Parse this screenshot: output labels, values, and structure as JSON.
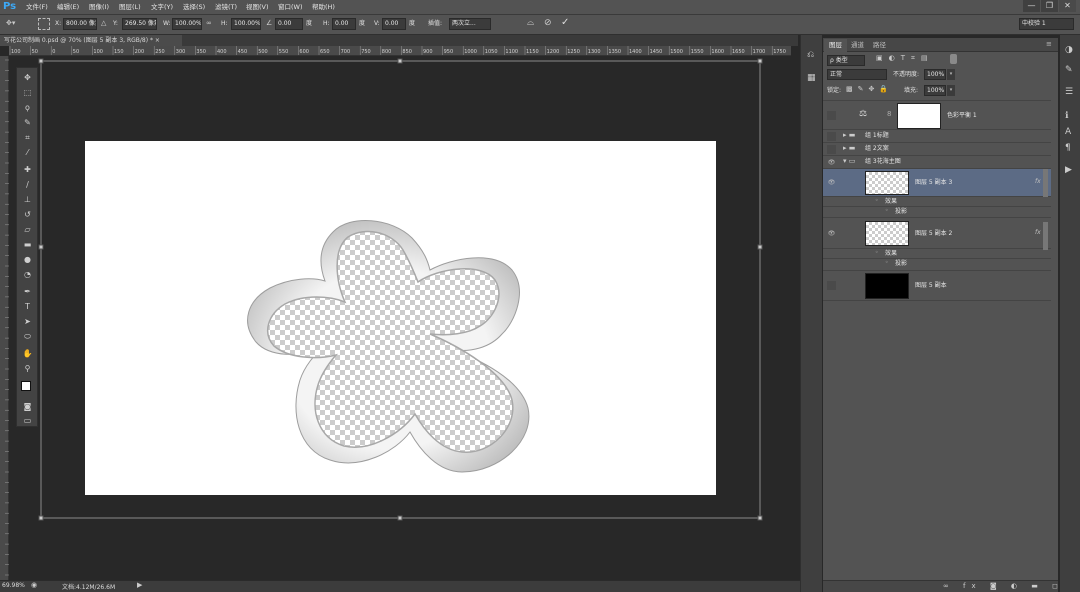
{
  "app": {
    "logo": "Ps"
  },
  "menu": [
    "文件(F)",
    "编辑(E)",
    "图像(I)",
    "图层(L)",
    "文字(Y)",
    "选择(S)",
    "滤镜(T)",
    "视图(V)",
    "窗口(W)",
    "帮助(H)"
  ],
  "window_controls": {
    "minimize": "—",
    "restore": "❐",
    "close": "✕"
  },
  "options": {
    "x_label": "X:",
    "x_value": "800.00 像素",
    "y_label": "Y:",
    "y_value": "269.50 像素",
    "w_label": "W:",
    "w_value": "100.00%",
    "h_label": "H:",
    "h_value": "100.00%",
    "angle_value": "0.00",
    "angle_unit": "度",
    "hskew_label": "H:",
    "hskew_value": "0.00",
    "hskew_unit": "度",
    "vskew_label": "V:",
    "vskew_value": "0.00",
    "vskew_unit": "度",
    "interp_label": "插值:",
    "interp_value": "两次立...",
    "workspace": "中校验 1"
  },
  "document_tab": "写花公司制画 0.psd @ 70% (图层 5 副本 3, RGB/8) * ×",
  "ruler_ticks": [
    "100",
    "50",
    "0",
    "50",
    "100",
    "150",
    "200",
    "250",
    "300",
    "350",
    "400",
    "450",
    "500",
    "550",
    "600",
    "650",
    "700",
    "750",
    "800",
    "850",
    "900",
    "950",
    "1000",
    "1050",
    "1100",
    "1150",
    "1200",
    "1250",
    "1300",
    "1350",
    "1400",
    "1450",
    "1500",
    "1550",
    "1600",
    "1650",
    "1700",
    "1750"
  ],
  "status": {
    "zoom": "69.98%",
    "doc": "文档:4.12M/26.6M"
  },
  "panel": {
    "tabs": [
      "图层",
      "通道",
      "路径"
    ],
    "kind_label": "ρ 类型",
    "blend_mode": "正常",
    "opacity_label": "不透明度:",
    "opacity_value": "100%",
    "lock_label": "锁定:",
    "fill_label": "填充:",
    "fill_value": "100%"
  },
  "layers": [
    {
      "name": "色彩平衡 1"
    },
    {
      "name": "组 1标题"
    },
    {
      "name": "组 2文案"
    },
    {
      "name": "组 3花海主图"
    },
    {
      "name": "图层 5 副本 3",
      "effects_label": "效果",
      "effect": "投影"
    },
    {
      "name": "图层 5 副本 2",
      "effects_label": "效果",
      "effect": "投影"
    },
    {
      "name": "图层 5 副本"
    }
  ],
  "fx_label": "fx"
}
